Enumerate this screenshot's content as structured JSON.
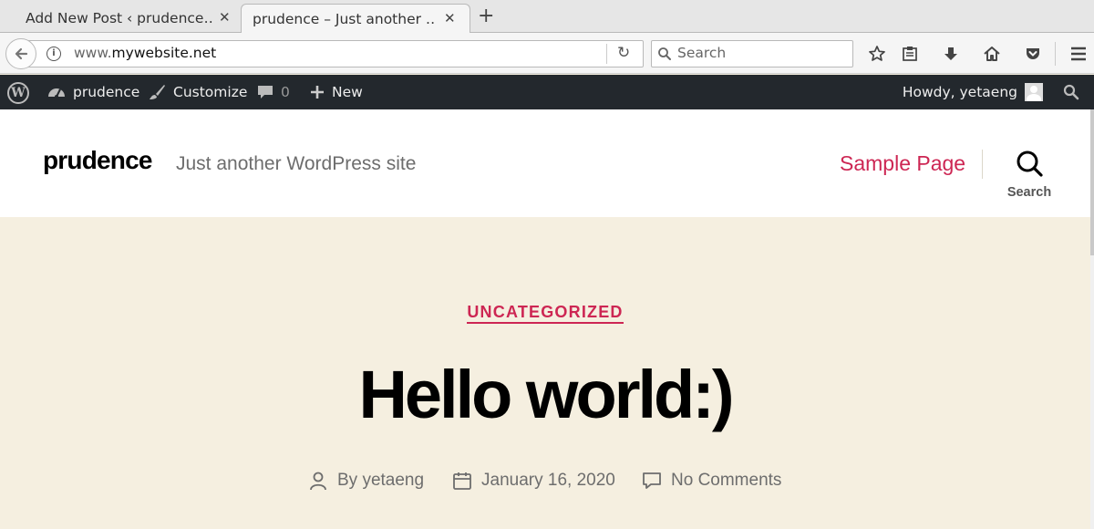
{
  "browser": {
    "tabs": [
      {
        "title": "Add New Post ‹ prudence…",
        "active": false
      },
      {
        "title": "prudence – Just another …",
        "active": true
      }
    ],
    "url": {
      "prefix": "www.",
      "domain": "mywebsite.net"
    },
    "search_placeholder": "Search",
    "toolbar_icons": [
      "star-icon",
      "reading-list-icon",
      "download-icon",
      "home-icon",
      "pocket-icon",
      "menu-icon"
    ]
  },
  "adminbar": {
    "site_name": "prudence",
    "customize": "Customize",
    "comments_count": "0",
    "new_label": "New",
    "howdy": "Howdy, yetaeng"
  },
  "site": {
    "title": "prudence",
    "description": "Just another WordPress site",
    "nav_item": "Sample Page",
    "search_label": "Search",
    "accent_color": "#cd2653",
    "hero_bg": "#f5efe0"
  },
  "post": {
    "category": "UNCATEGORIZED",
    "title": "Hello world:)",
    "author": "By yetaeng",
    "date": "January 16, 2020",
    "comments": "No Comments"
  }
}
